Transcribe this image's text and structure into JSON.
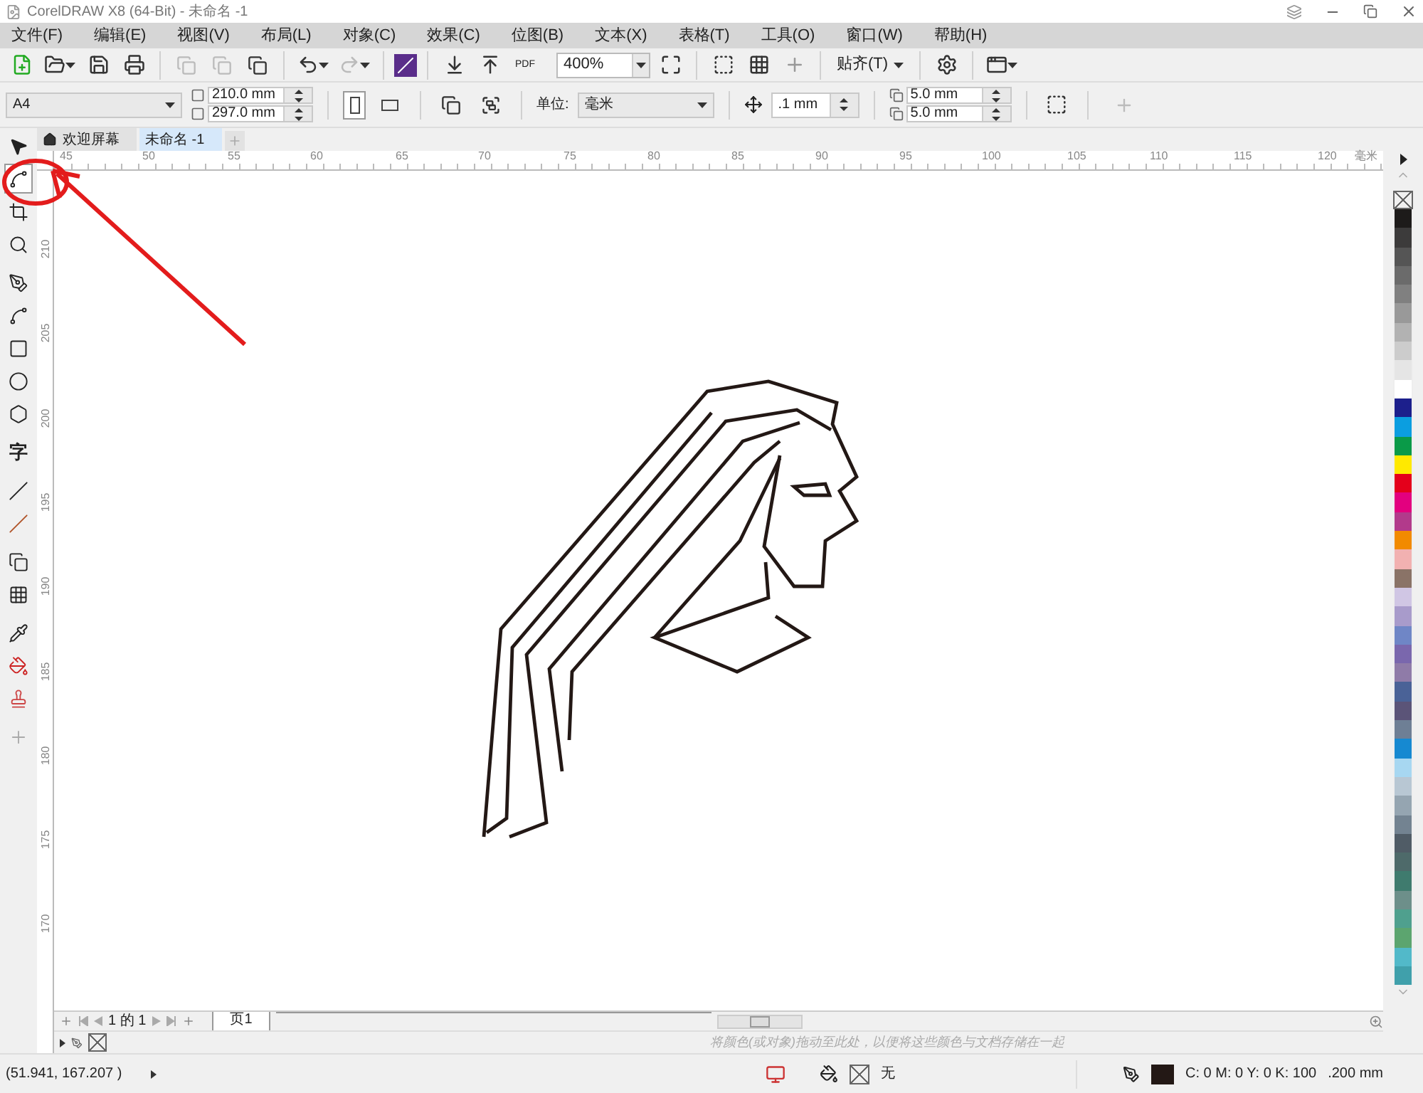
{
  "window": {
    "title": "CorelDRAW X8 (64-Bit) - 未命名 -1"
  },
  "menu": [
    "文件(F)",
    "编辑(E)",
    "视图(V)",
    "布局(L)",
    "对象(C)",
    "效果(C)",
    "位图(B)",
    "文本(X)",
    "表格(T)",
    "工具(O)",
    "窗口(W)",
    "帮助(H)"
  ],
  "toolbar": {
    "zoom": "400%",
    "pdf_label": "PDF",
    "snap": "贴齐(T)"
  },
  "property_bar": {
    "page_size": "A4",
    "width": "210.0 mm",
    "height": "297.0 mm",
    "units_label": "单位:",
    "units": "毫米",
    "nudge": ".1 mm",
    "dup_x": "5.0 mm",
    "dup_y": "5.0 mm"
  },
  "tabs": [
    {
      "label": "欢迎屏幕",
      "selected": false,
      "kind": "home"
    },
    {
      "label": "未命名 -1",
      "selected": true,
      "kind": "doc"
    }
  ],
  "ruler": {
    "h": [
      "45",
      "50",
      "55",
      "60",
      "65",
      "70",
      "75",
      "80",
      "85",
      "90",
      "95",
      "100",
      "105",
      "110",
      "115",
      "120"
    ],
    "unit": "毫米",
    "v": [
      "210",
      "205",
      "200",
      "195",
      "190",
      "185",
      "180",
      "175",
      "170"
    ]
  },
  "toolbox": [
    {
      "kind": "pick",
      "selected": false
    },
    {
      "kind": "shape",
      "selected": true
    },
    {
      "kind": "crop",
      "selected": false
    },
    {
      "kind": "zoom",
      "selected": false
    },
    {
      "kind": "pen",
      "selected": false
    },
    {
      "kind": "curve",
      "selected": false
    },
    {
      "kind": "rect",
      "selected": false
    },
    {
      "kind": "ellipse",
      "selected": false
    },
    {
      "kind": "polygon",
      "selected": false
    },
    {
      "kind": "text",
      "selected": false,
      "glyph": "字"
    },
    {
      "kind": "dimension",
      "selected": false
    },
    {
      "kind": "connector",
      "selected": false
    },
    {
      "kind": "shadow",
      "selected": false
    },
    {
      "kind": "transparency",
      "selected": false
    },
    {
      "kind": "eyedropper",
      "selected": false
    },
    {
      "kind": "fill",
      "selected": false
    },
    {
      "kind": "outline",
      "selected": false
    },
    {
      "kind": "add",
      "selected": false
    }
  ],
  "page_nav": {
    "count": "1 的 1",
    "page_tab": "页1"
  },
  "color_hint": "将颜色(或对象)拖动至此处，以便将这些颜色与文档存储在一起",
  "palette": [
    {
      "color": "#1d1b1a"
    },
    {
      "color": "#3c3b3b"
    },
    {
      "color": "#555555"
    },
    {
      "color": "#6b6b6b"
    },
    {
      "color": "#808080"
    },
    {
      "color": "#999999"
    },
    {
      "color": "#b2b2b2"
    },
    {
      "color": "#cccccc"
    },
    {
      "color": "#e5e5e5"
    },
    {
      "color": "#ffffff"
    },
    {
      "color": "#1c1f8c"
    },
    {
      "color": "#0b9ee0"
    },
    {
      "color": "#0a9a48"
    },
    {
      "color": "#ffe900"
    },
    {
      "color": "#e4001b"
    },
    {
      "color": "#e3007f"
    },
    {
      "color": "#b23a8b"
    },
    {
      "color": "#f28a00"
    },
    {
      "color": "#f2b1b1"
    },
    {
      "color": "#8a7367"
    },
    {
      "color": "#d0c6e4"
    },
    {
      "color": "#a89bcb"
    },
    {
      "color": "#6f86c6"
    },
    {
      "color": "#7a67ad"
    },
    {
      "color": "#8f7ba8"
    },
    {
      "color": "#4a6297"
    },
    {
      "color": "#5b5478"
    },
    {
      "color": "#6e7f95"
    },
    {
      "color": "#1689d1"
    },
    {
      "color": "#a7d7f1"
    },
    {
      "color": "#b8c7d3"
    },
    {
      "color": "#95a5b1"
    },
    {
      "color": "#738391"
    },
    {
      "color": "#505c66"
    },
    {
      "color": "#4e6a6a"
    },
    {
      "color": "#3f7b6e"
    },
    {
      "color": "#6d8f8a"
    },
    {
      "color": "#4fa08e"
    },
    {
      "color": "#5ca56f"
    },
    {
      "color": "#52b9c9"
    },
    {
      "color": "#40a0ab"
    }
  ],
  "status": {
    "coords": "(51.941, 167.207 )",
    "fill": "无",
    "outline_color": "C: 0 M: 0 Y: 0 K: 100",
    "outline_width": ".200 mm"
  }
}
